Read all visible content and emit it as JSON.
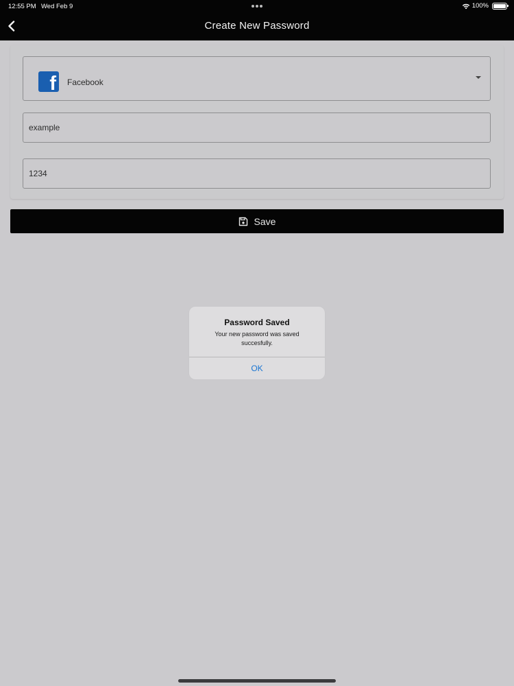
{
  "status_bar": {
    "time": "12:55 PM",
    "date": "Wed Feb 9",
    "battery": "100%"
  },
  "nav": {
    "title": "Create New Password",
    "back_icon": "chevron-left-icon"
  },
  "form": {
    "account_select": {
      "selected": "Facebook",
      "icon": "facebook-icon",
      "icon_color": "#1a5fb0"
    },
    "username": {
      "value": "example"
    },
    "password": {
      "value": "1234"
    }
  },
  "save_button": {
    "label": "Save",
    "icon": "floppy-disk-icon"
  },
  "alert": {
    "title": "Password Saved",
    "message": "Your new password was saved succesfully.",
    "ok_label": "OK",
    "ok_color": "#1a75d2"
  }
}
